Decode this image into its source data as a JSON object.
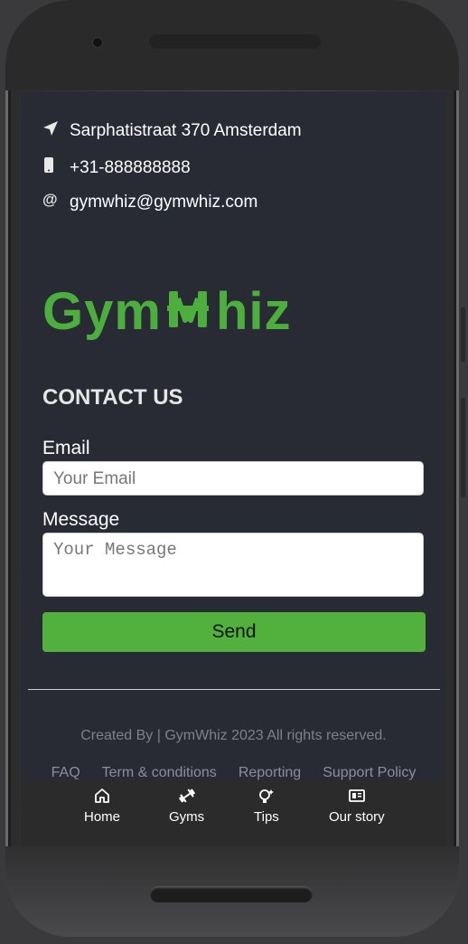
{
  "contact_info": {
    "address": "Sarphatistraat 370 Amsterdam",
    "phone": "+31-888888888",
    "email": "gymwhiz@gymwhiz.com"
  },
  "brand": {
    "name_part1": "Gym",
    "name_part2": "hiz",
    "color": "#4cae3d"
  },
  "contact_form": {
    "title": "CONTACT US",
    "email_label": "Email",
    "email_placeholder": "Your Email",
    "message_label": "Message",
    "message_placeholder": "Your Message",
    "send_label": "Send",
    "button_color": "#52b13c"
  },
  "footer": {
    "copyright": "Created By | GymWhiz 2023 All rights reserved.",
    "links": [
      "FAQ",
      "Term & conditions",
      "Reporting",
      "Support Policy"
    ]
  },
  "tabbar": {
    "items": [
      {
        "label": "Home",
        "icon": "home-icon"
      },
      {
        "label": "Gyms",
        "icon": "dumbbell-icon"
      },
      {
        "label": "Tips",
        "icon": "lightbulb-icon"
      },
      {
        "label": "Our story",
        "icon": "newspaper-icon"
      }
    ]
  }
}
